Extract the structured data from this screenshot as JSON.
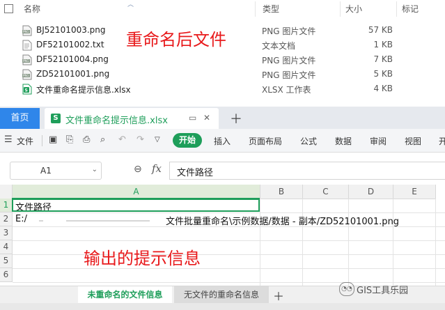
{
  "explorer": {
    "columns": {
      "name": "名称",
      "type": "类型",
      "size": "大小",
      "tags": "标记"
    },
    "files": [
      {
        "name": "BJ52101003.png",
        "type": "PNG 图片文件",
        "size": "57 KB",
        "icon": "png-file-icon"
      },
      {
        "name": "DF52101002.txt",
        "type": "文本文档",
        "size": "1 KB",
        "icon": "txt-file-icon"
      },
      {
        "name": "DF52101004.png",
        "type": "PNG 图片文件",
        "size": "7 KB",
        "icon": "png-file-icon"
      },
      {
        "name": "ZD52101001.png",
        "type": "PNG 图片文件",
        "size": "5 KB",
        "icon": "png-file-icon"
      },
      {
        "name": "文件重命名提示信息.xlsx",
        "type": "XLSX 工作表",
        "size": "4 KB",
        "icon": "xlsx-file-icon"
      }
    ],
    "annotation": "重命名后文件"
  },
  "tabs": {
    "home": "首页",
    "document": "文件重命名提示信息.xlsx",
    "doc_icon": "S"
  },
  "ribbon": {
    "file": "文件",
    "start": "开始",
    "items": [
      "插入",
      "页面布局",
      "公式",
      "数据",
      "审阅",
      "视图",
      "开"
    ]
  },
  "formula_bar": {
    "cell_ref": "A1",
    "fx": "fx",
    "content": "文件路径"
  },
  "grid": {
    "columns": [
      "A",
      "B",
      "C",
      "D",
      "E"
    ],
    "rows": [
      "1",
      "2",
      "3",
      "4",
      "5",
      "6"
    ],
    "a1": "文件路径",
    "a2_prefix": "E:/",
    "a2_suffix": "文件批量重命名\\示例数据/数据 - 副本/ZD52101001.png",
    "annotation": "输出的提示信息"
  },
  "sheets": [
    "未重命名的文件信息",
    "无文件的重命名信息"
  ],
  "watermark": "GIS工具乐园",
  "colors": {
    "accent_green": "#1e9e5a",
    "home_tab_blue": "#2f86ea",
    "annotation_red": "#e8191b"
  }
}
